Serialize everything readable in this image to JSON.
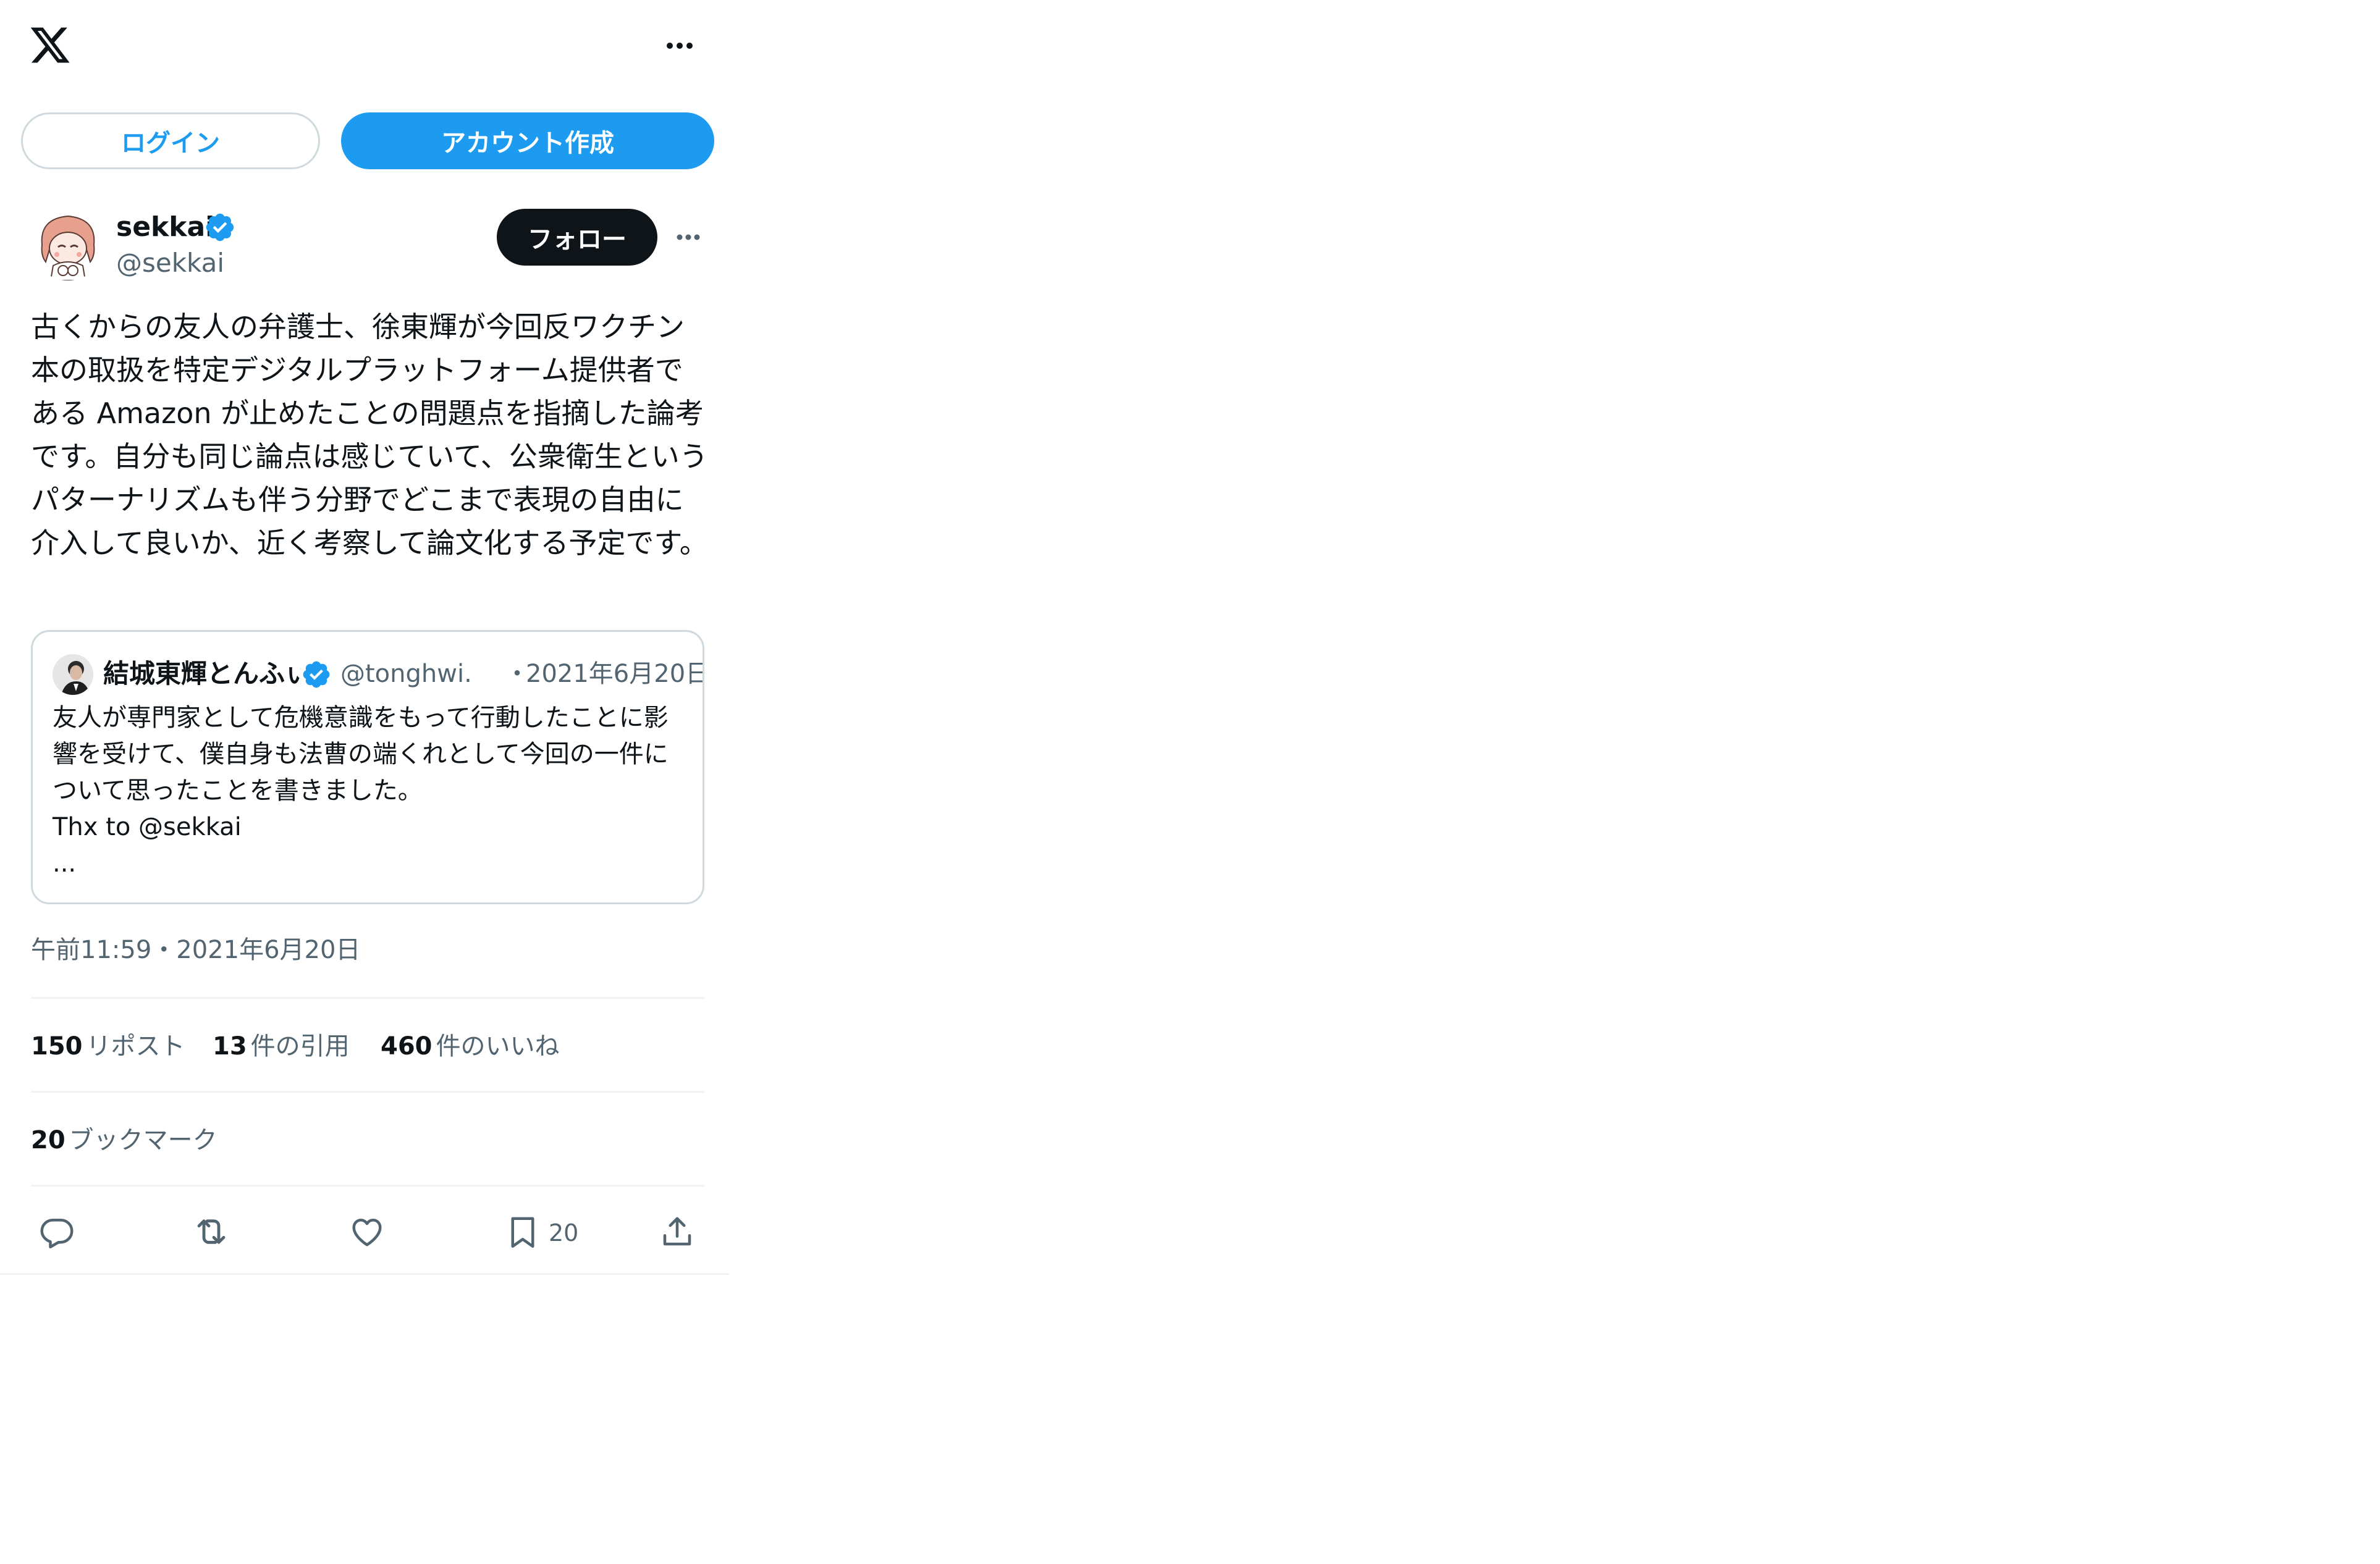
{
  "header": {
    "logo_icon": "x-logo-icon",
    "more_icon": "more-horizontal-icon"
  },
  "auth": {
    "login_label": "ログイン",
    "signup_label": "アカウント作成"
  },
  "tweet": {
    "author": {
      "name": "sekkai",
      "handle": "@sekkai",
      "verified": true
    },
    "follow_label": "フォロー",
    "text": "古くからの友人の弁護士、徐東輝が今回反ワクチン本の取扱を特定デジタルプラットフォーム提供者である Amazon が止めたことの問題点を指摘した論考です。自分も同じ論点は感じていて、公衆衛生というパターナリズムも伴う分野でどこまで表現の自由に介入して良いか、近く考察して論文化する予定です。",
    "quote": {
      "name": "結城東輝とんふぃ",
      "handle": "@tonghwi.",
      "separator": "・",
      "date": "2021年6月20日",
      "verified": true,
      "text": "友人が専門家として危機意識をもって行動したことに影響を受けて、僕自身も法曹の端くれとして今回の一件について思ったことを書きました。\nThx to @sekkai\n..."
    },
    "timestamp": "午前11:59・2021年6月20日",
    "stats": {
      "reposts": {
        "count": "150",
        "label": "リポスト"
      },
      "quotes": {
        "count": "13",
        "label": "件の引用"
      },
      "likes": {
        "count": "460",
        "label": "件のいいね"
      },
      "bookmarks": {
        "count": "20",
        "label": "ブックマーク"
      }
    },
    "actions": {
      "reply_icon": "reply-icon",
      "repost_icon": "repost-icon",
      "like_icon": "heart-icon",
      "bookmark_icon": "bookmark-icon",
      "bookmark_count": "20",
      "share_icon": "share-icon"
    }
  },
  "colors": {
    "accent": "#1d9bf0",
    "text_primary": "#0f1419",
    "text_secondary": "#536471",
    "border": "#cfd9de",
    "divider": "#eff3f4"
  }
}
